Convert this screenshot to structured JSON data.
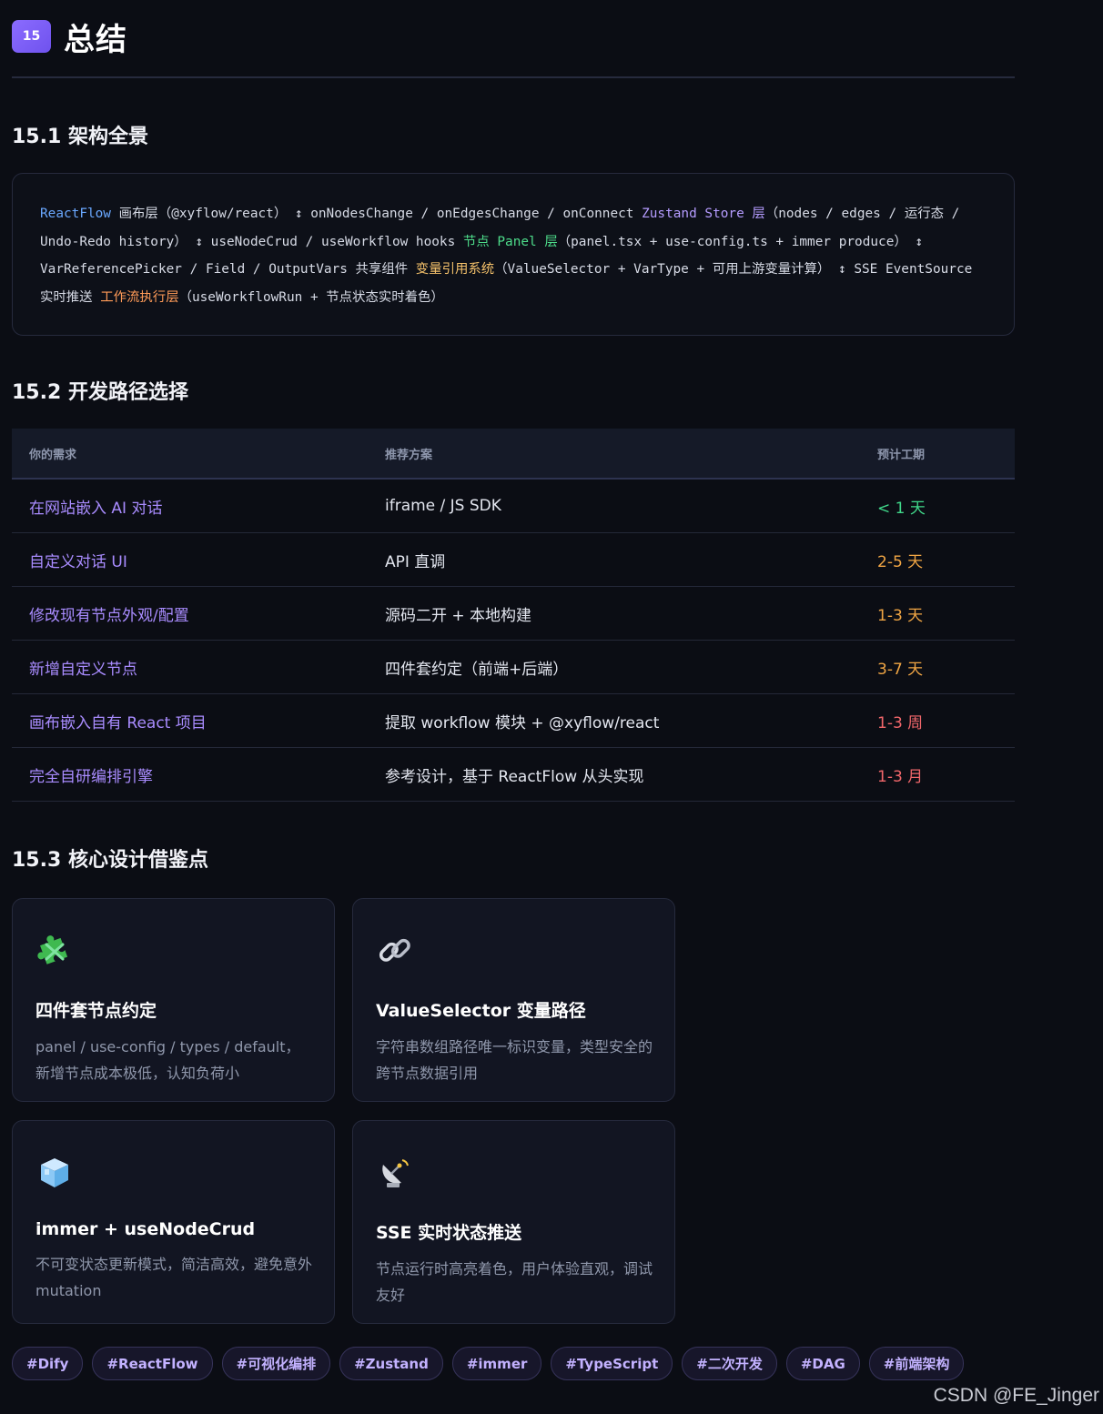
{
  "header": {
    "badge": "15",
    "title": "总结"
  },
  "sections": {
    "s1": "15.1 架构全景",
    "s2": "15.2 开发路径选择",
    "s3": "15.3 核心设计借鉴点"
  },
  "architecture": {
    "seg1": "ReactFlow",
    "seg2": " 画布层（@xyflow/react） ↕ onNodesChange / onEdgesChange / onConnect ",
    "seg3": "Zustand Store",
    "seg4": " 层",
    "seg5": "（nodes / edges / 运行态 / Undo-Redo history） ↕ useNodeCrud / useWorkflow hooks ",
    "seg6": "节点 Panel 层",
    "seg7": "（panel.tsx + use-config.ts + immer produce） ↕ VarReferencePicker / Field / OutputVars 共享组件 ",
    "seg8": "变量引用系统",
    "seg9": "（ValueSelector + VarType + 可用上游变量计算） ↕ SSE EventSource 实时推送 ",
    "seg10": "工作流执行层",
    "seg11": "（useWorkflowRun + 节点状态实时着色）"
  },
  "table": {
    "headers": [
      "你的需求",
      "推荐方案",
      "预计工期"
    ],
    "rows": [
      {
        "need": "在网站嵌入 AI 对话",
        "plan": "iframe / JS SDK",
        "time": "< 1 天",
        "level": "green"
      },
      {
        "need": "自定义对话 UI",
        "plan": "API 直调",
        "time": "2-5 天",
        "level": "orange"
      },
      {
        "need": "修改现有节点外观/配置",
        "plan": "源码二开 + 本地构建",
        "time": "1-3 天",
        "level": "orange"
      },
      {
        "need": "新增自定义节点",
        "plan": "四件套约定（前端+后端）",
        "time": "3-7 天",
        "level": "orange"
      },
      {
        "need": "画布嵌入自有 React 项目",
        "plan": "提取 workflow 模块 + @xyflow/react",
        "time": "1-3 周",
        "level": "red"
      },
      {
        "need": "完全自研编排引擎",
        "plan": "参考设计，基于 ReactFlow 从头实现",
        "time": "1-3 月",
        "level": "red"
      }
    ]
  },
  "cards": [
    {
      "icon": "puzzle-icon",
      "title": "四件套节点约定",
      "desc": "panel / use-config / types / default，新增节点成本极低，认知负荷小"
    },
    {
      "icon": "link-icon",
      "title": "ValueSelector 变量路径",
      "desc": "字符串数组路径唯一标识变量，类型安全的跨节点数据引用"
    },
    {
      "icon": "ice-cube-icon",
      "title": "immer + useNodeCrud",
      "desc": "不可变状态更新模式，简洁高效，避免意外 mutation"
    },
    {
      "icon": "satellite-dish-icon",
      "title": "SSE 实时状态推送",
      "desc": "节点运行时高亮着色，用户体验直观，调试友好"
    }
  ],
  "tags": [
    "#Dify",
    "#ReactFlow",
    "#可视化编排",
    "#Zustand",
    "#immer",
    "#TypeScript",
    "#二次开发",
    "#DAG",
    "#前端架构"
  ],
  "watermark": "CSDN @FE_Jinger",
  "colors": {
    "accent": "#8b6cff",
    "green": "#40d88a",
    "orange": "#f0a544",
    "red": "#f2676b"
  }
}
